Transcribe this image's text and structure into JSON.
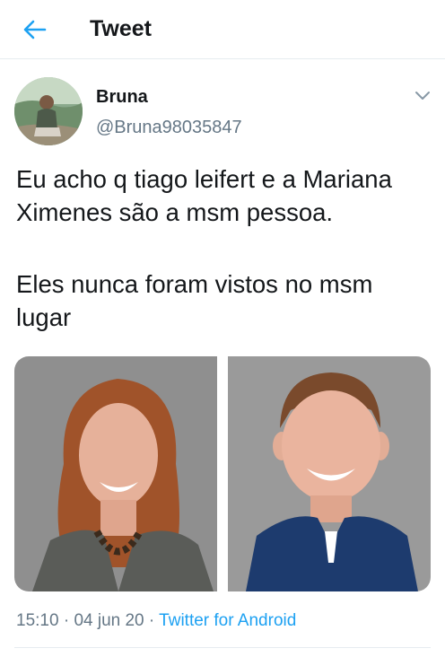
{
  "header": {
    "title": "Tweet",
    "back_icon": "arrow-left-icon",
    "accent": "#1da1f2"
  },
  "tweet": {
    "author_name": "Bruna",
    "author_handle": "@Bruna98035847",
    "text_paragraph_1": "Eu acho q tiago leifert e a Mariana Ximenes são a msm pessoa.",
    "text_paragraph_2": "Eles nunca foram vistos no msm lugar",
    "time": "15:10",
    "separator": "·",
    "date": "04 jun 20",
    "client": "Twitter for Android"
  },
  "colors": {
    "text": "#14171a",
    "secondary": "#657786",
    "link": "#1da1f2",
    "divider": "#e6ecf0"
  }
}
